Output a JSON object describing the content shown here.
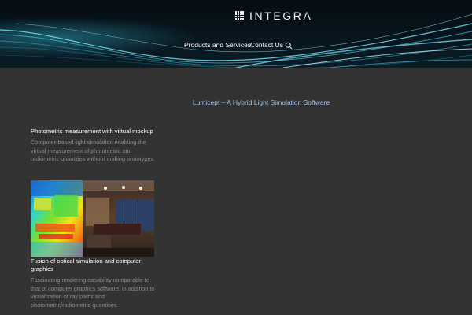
{
  "header": {
    "logo_text": "INTEGRA",
    "nav": [
      {
        "label": "Products and Services"
      },
      {
        "label": "Contact Us"
      }
    ],
    "search_icon": "search-icon"
  },
  "page": {
    "title": "Lumicept – A Hybrid Light Simulation Software"
  },
  "sections": [
    {
      "heading": "Photometric measurement with virtual mockup",
      "body": "Computer-based light simulation enabling the virtual measurement of photometric and radiometric quantities without making prototypes."
    },
    {
      "heading": "Fusion of optical simulation and computer graphics",
      "body": "Fascinating rendering capability comparable to that of computer graphics software, in addition to visualization of ray paths and photometric/radiometric quantities."
    }
  ],
  "colors": {
    "background": "#333333",
    "header_bg": "#061018",
    "title_link": "#9fc3e6",
    "body_text": "#8b8b8b"
  }
}
